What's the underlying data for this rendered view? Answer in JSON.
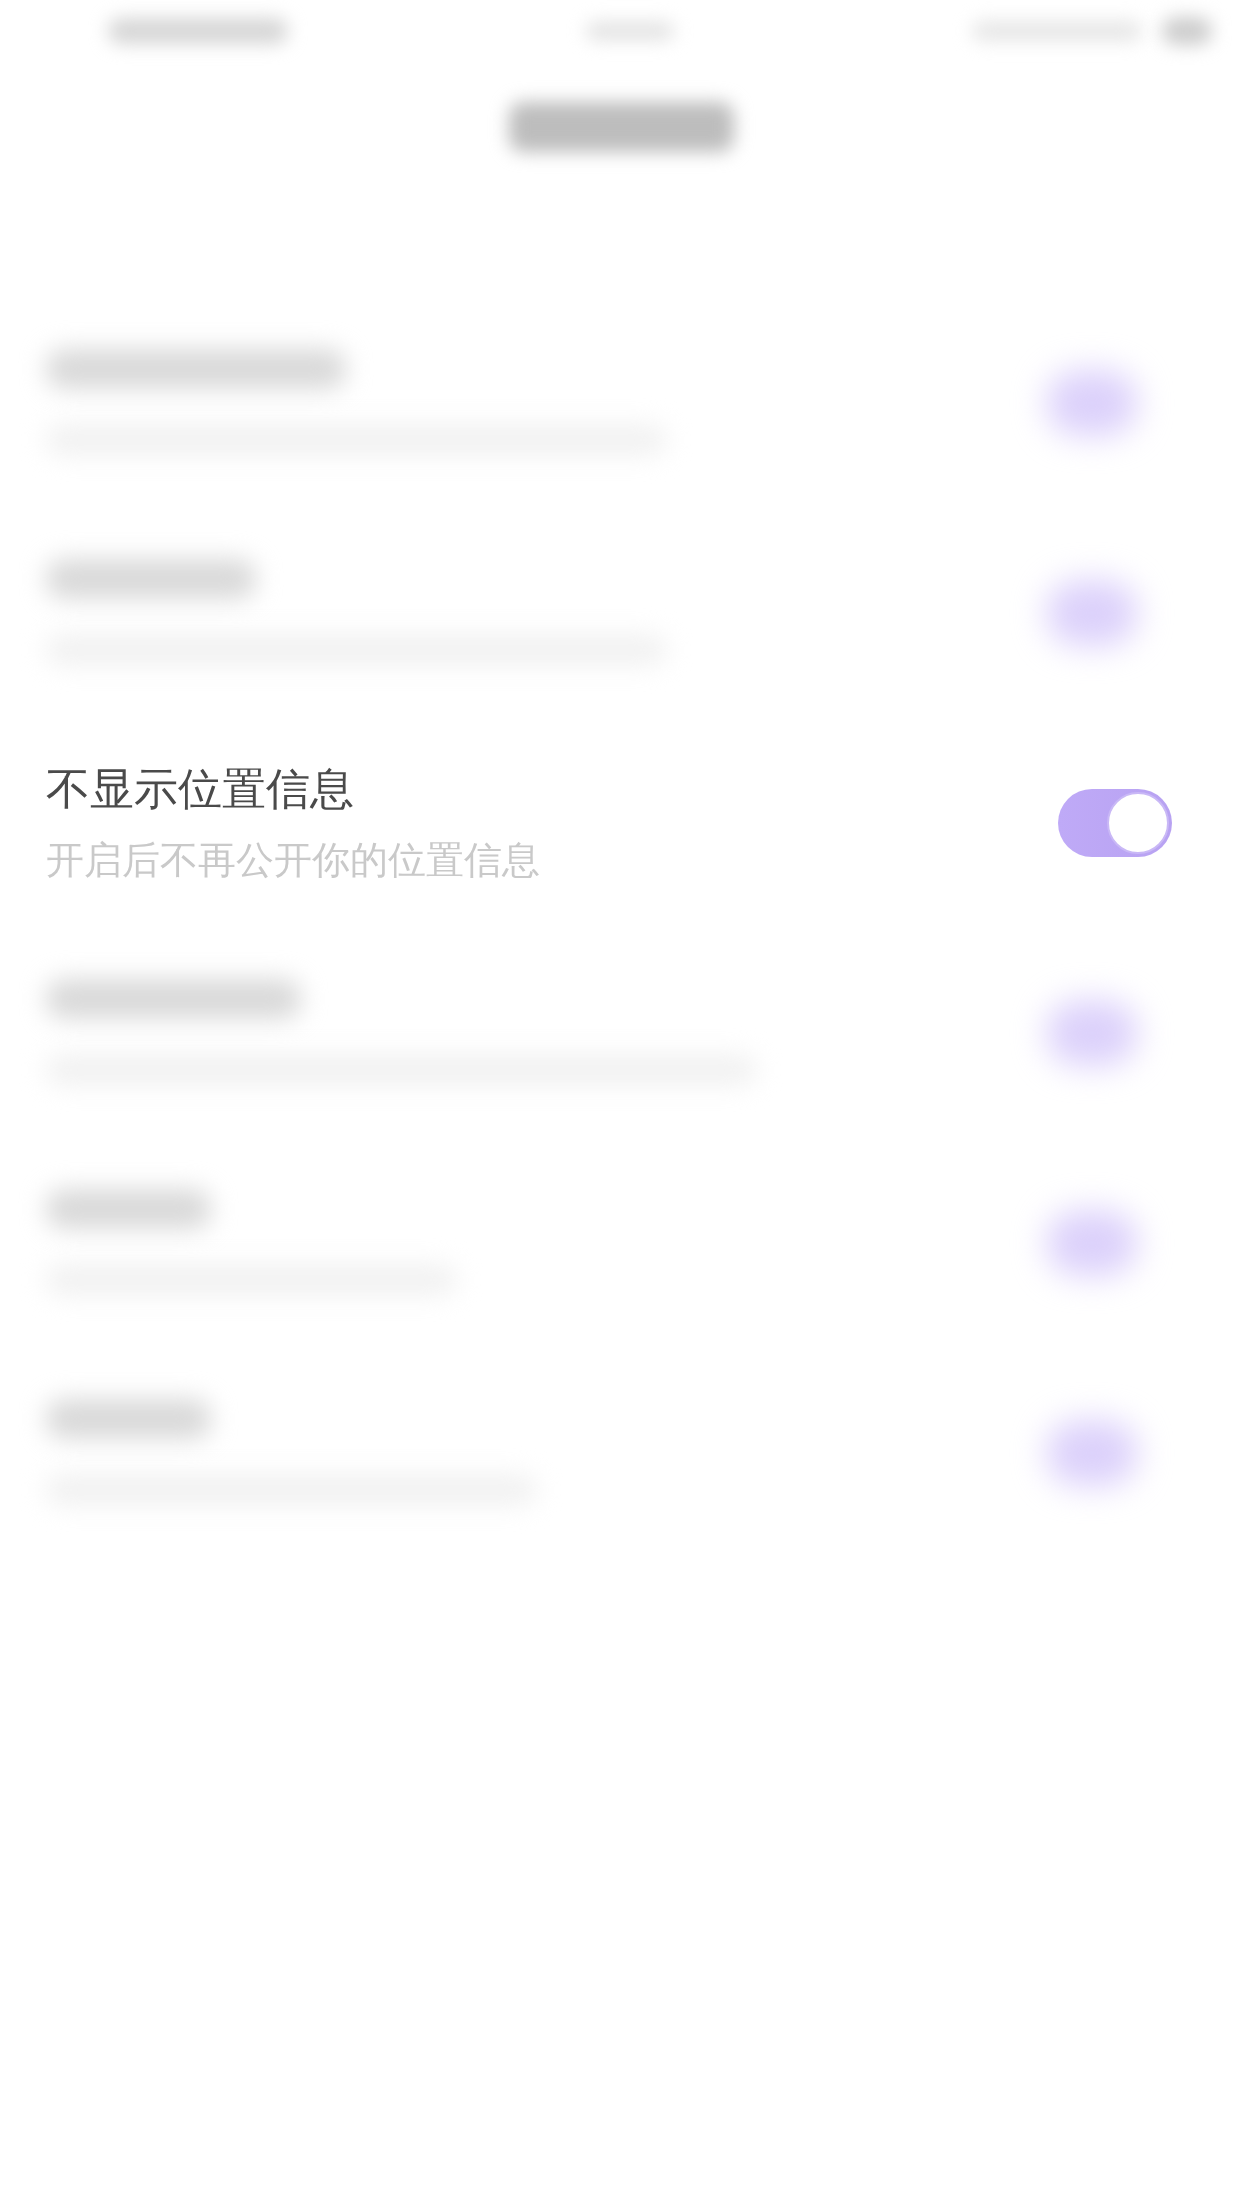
{
  "status_bar": {
    "kind": "blurred"
  },
  "nav_bar": {
    "kind": "blurred"
  },
  "settings": [
    {
      "kind": "blurred",
      "on": true
    },
    {
      "kind": "blurred",
      "on": true
    },
    {
      "kind": "clear",
      "title": "不显示位置信息",
      "subtitle": "开启后不再公开你的位置信息",
      "on": true
    },
    {
      "kind": "blurred",
      "on": true
    },
    {
      "kind": "blurred",
      "on": true
    },
    {
      "kind": "blurred",
      "on": true
    }
  ]
}
